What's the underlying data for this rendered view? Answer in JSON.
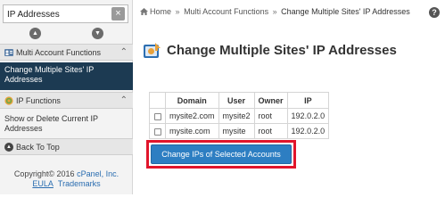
{
  "sidebar": {
    "search_value": "IP Addresses",
    "clear_glyph": "×",
    "sections": [
      {
        "label": "Multi Account Functions",
        "icon": "accounts-icon",
        "items": [
          {
            "label_line1": "Change Multiple Sites' IP",
            "label_line2": "Addresses",
            "active": true
          }
        ]
      },
      {
        "label": "IP Functions",
        "icon": "ip-globe-icon",
        "items": [
          {
            "label_line1": "Show or Delete Current IP",
            "label_line2": "Addresses",
            "active": false
          }
        ]
      }
    ],
    "back_to_top": "Back To Top",
    "footer": {
      "copyright_prefix": "Copyright© 2016 ",
      "brand_link": "cPanel, Inc.",
      "eula": "EULA",
      "trademarks": "Trademarks"
    }
  },
  "breadcrumb": {
    "home": "Home",
    "separator": "»",
    "parent": "Multi Account Functions",
    "current": "Change Multiple Sites' IP Addresses"
  },
  "help_glyph": "?",
  "page": {
    "title": "Change Multiple Sites' IP Addresses"
  },
  "table": {
    "columns": [
      "",
      "Domain",
      "User",
      "Owner",
      "IP"
    ],
    "rows": [
      {
        "checked": false,
        "domain": "mysite2.com",
        "user": "mysite2",
        "owner": "root",
        "ip": "192.0.2.0"
      },
      {
        "checked": false,
        "domain": "mysite.com",
        "user": "mysite",
        "owner": "root",
        "ip": "192.0.2.0"
      }
    ]
  },
  "action_button": "Change IPs of Selected Accounts",
  "colors": {
    "active_nav_bg": "#1c3a52",
    "button_bg": "#2d7ec2",
    "highlight_border": "#e1152b",
    "link": "#2a6db0"
  }
}
